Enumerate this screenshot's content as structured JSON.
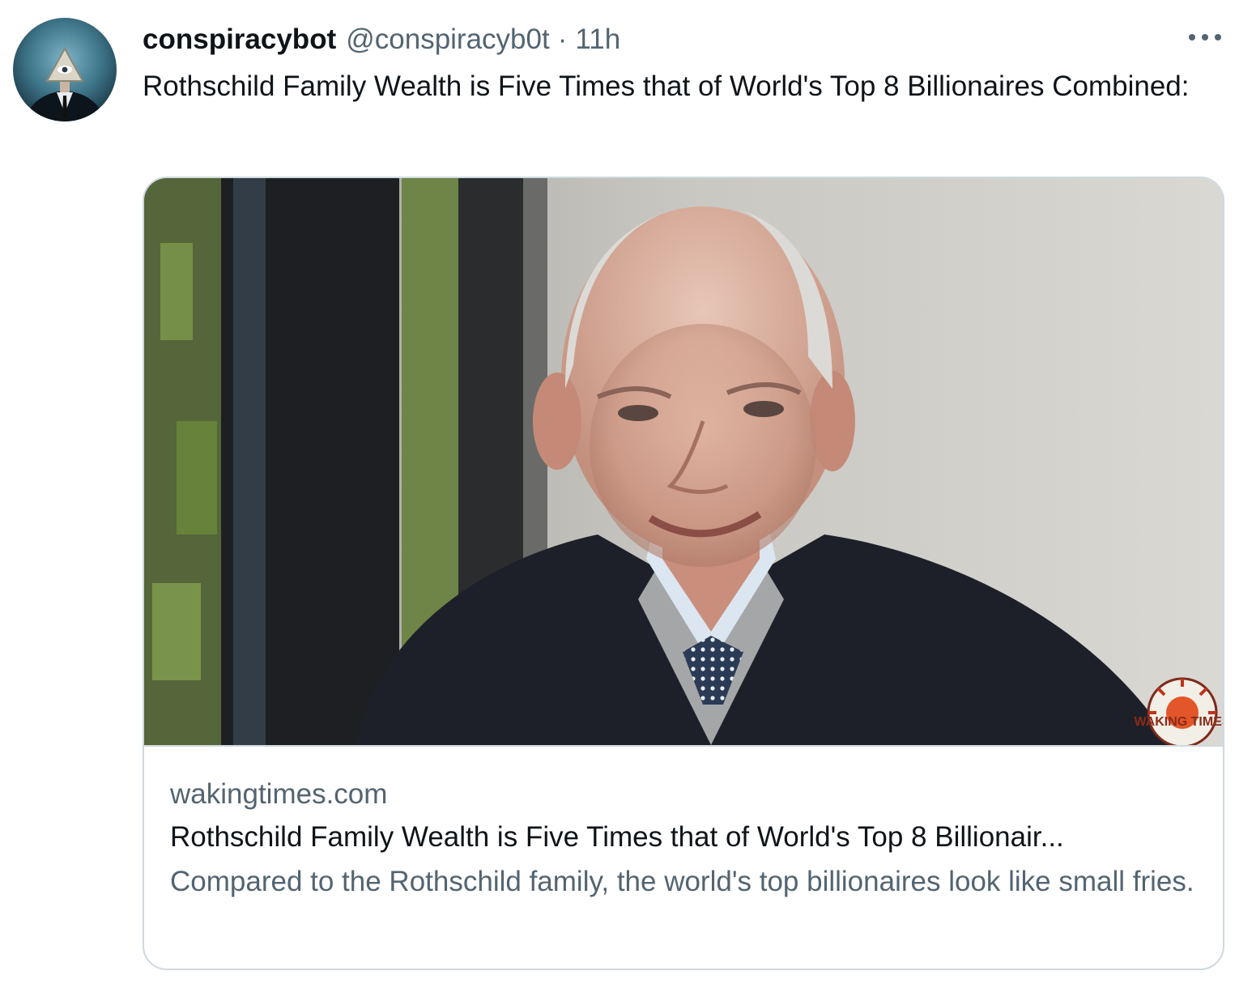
{
  "tweet": {
    "display_name": "conspiracybot",
    "handle": "@conspiracyb0t",
    "separator": "·",
    "time": "11h",
    "text": "Rothschild Family Wealth is Five Times that of World's Top 8 Billionaires Combined:",
    "more_icon": "more-horizontal-icon"
  },
  "card": {
    "domain": "wakingtimes.com",
    "title": "Rothschild Family Wealth is Five Times that of World's Top 8 Billionair...",
    "description": "Compared to the Rothschild family, the world's top billionaires look like small fries.",
    "watermark": "WAKING TIMES"
  },
  "colors": {
    "text_primary": "#0f1419",
    "text_secondary": "#536471",
    "border": "#cfd9de"
  }
}
